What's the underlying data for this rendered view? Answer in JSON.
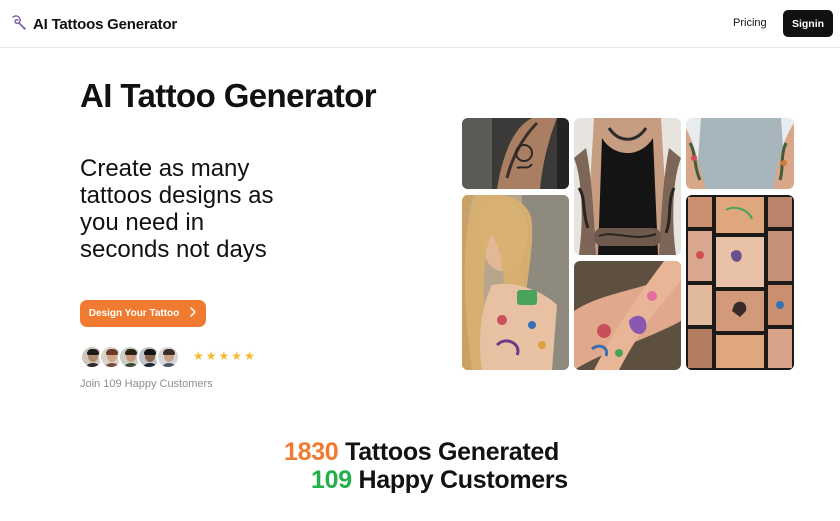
{
  "nav": {
    "brand": "AI Tattoos Generator",
    "pricing": "Pricing",
    "signin": "Signin"
  },
  "hero": {
    "title": "AI Tattoo Generator",
    "subtitle": "Create as many tattoos designs as you need in seconds not days",
    "cta": "Design Your Tattoo",
    "rating_stars": 5,
    "join_text": "Join 109 Happy Customers"
  },
  "gallery": {
    "images": [
      "arm-sleeve-tattoo",
      "chest-and-arms-tattoo",
      "shoulder-tattoo",
      "woman-colorful-tattoos",
      "colorful-forearm-tattoos",
      "tattoo-collage"
    ]
  },
  "stats": {
    "tattoos_count": "1830",
    "tattoos_label": "Tattoos Generated",
    "customers_count": "109",
    "customers_label": "Happy Customers"
  },
  "colors": {
    "accent_orange": "#f07a2f",
    "accent_green": "#22b04b",
    "dark": "#111111",
    "star": "#f5b82e"
  }
}
